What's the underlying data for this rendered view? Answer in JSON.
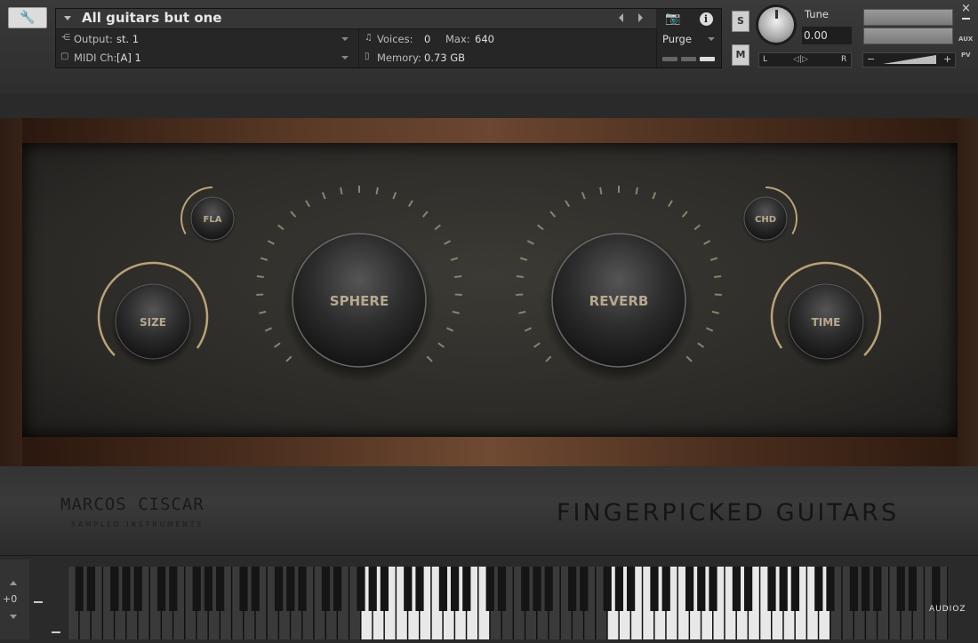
{
  "header": {
    "instrument_name": "All guitars but one",
    "output_label": "Output:",
    "output_value": "st. 1",
    "midi_label": "MIDI Ch:",
    "midi_value": "[A]  1",
    "voices_label": "Voices:",
    "voices_value": "0",
    "max_label": "Max:",
    "max_value": "640",
    "memory_label": "Memory:",
    "memory_value": "0.73 GB",
    "purge_label": "Purge",
    "solo_label": "S",
    "mute_label": "M",
    "tune_label": "Tune",
    "tune_value": "0.00",
    "pan_left": "L",
    "pan_right": "R",
    "pan_center": "◁|▷",
    "vol_minus": "−",
    "vol_plus": "+",
    "aux_label": "AUX",
    "pv_label": "PV",
    "close_label": "×",
    "info_label": "i",
    "icons": {
      "wrench": "wrench-icon",
      "camera": "camera-icon",
      "info": "info-icon"
    }
  },
  "panel": {
    "knobs": {
      "fla": "FLA",
      "size": "SIZE",
      "sphere": "SPHERE",
      "reverb": "REVERB",
      "chd": "CHD",
      "time": "TIME"
    },
    "accent_color": "#b8a27a",
    "knob_label_color": "#b8a890"
  },
  "branding": {
    "maker": "MARCOS CISCAR",
    "maker_sub": "SAMPLED INSTRUMENTS",
    "product": "FINGERPICKED GUITARS",
    "watermark": "AUDIOZ"
  },
  "keyboard": {
    "octave_value": "+0"
  }
}
